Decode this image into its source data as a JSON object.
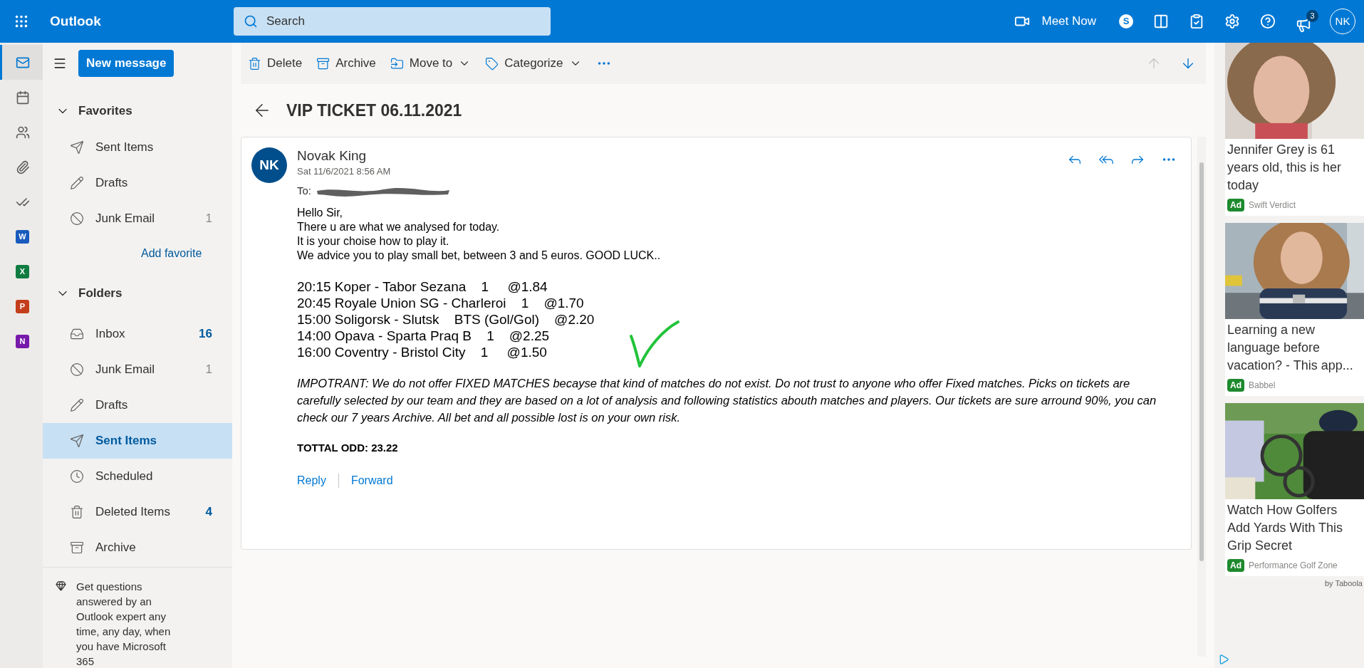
{
  "app_bar": {
    "app_name": "Outlook",
    "search": {
      "placeholder": "Search"
    },
    "meet_now": "Meet Now",
    "skype_letter": "S",
    "notification_count": "3",
    "avatar": "NK"
  },
  "rail": [
    {
      "kind": "mail",
      "selected": true
    },
    {
      "kind": "calendar",
      "selected": false
    },
    {
      "kind": "people",
      "selected": false
    },
    {
      "kind": "files",
      "selected": false
    },
    {
      "kind": "todo",
      "selected": false
    },
    {
      "kind": "app",
      "letter": "W",
      "color": "#185abd",
      "selected": false
    },
    {
      "kind": "app",
      "letter": "X",
      "color": "#107c41",
      "selected": false
    },
    {
      "kind": "app",
      "letter": "P",
      "color": "#c43e1c",
      "selected": false
    },
    {
      "kind": "app",
      "letter": "N",
      "color": "#7719aa",
      "selected": false
    }
  ],
  "folder_pane": {
    "new_message": "New message",
    "sections": [
      {
        "title": "Favorites",
        "expanded": true,
        "items": [
          {
            "kind": "sent",
            "label": "Sent Items",
            "selected": false
          },
          {
            "kind": "drafts",
            "label": "Drafts",
            "selected": false
          },
          {
            "kind": "junk",
            "label": "Junk Email",
            "count": "1",
            "unread": false,
            "selected": false
          }
        ],
        "add_link": "Add favorite"
      },
      {
        "title": "Folders",
        "expanded": true,
        "items": [
          {
            "kind": "inbox",
            "label": "Inbox",
            "count": "16",
            "unread": true,
            "selected": false
          },
          {
            "kind": "junk",
            "label": "Junk Email",
            "count": "1",
            "unread": false,
            "selected": false
          },
          {
            "kind": "drafts",
            "label": "Drafts",
            "selected": false
          },
          {
            "kind": "sent",
            "label": "Sent Items",
            "selected": true
          },
          {
            "kind": "scheduled",
            "label": "Scheduled",
            "selected": false
          },
          {
            "kind": "deleted",
            "label": "Deleted Items",
            "count": "4",
            "unread": true,
            "selected": false
          },
          {
            "kind": "archive",
            "label": "Archive",
            "selected": false
          }
        ]
      }
    ],
    "upsell": "Get questions answered by an Outlook expert any time, any day, when you have Microsoft 365"
  },
  "toolbar": {
    "items": [
      {
        "kind": "delete",
        "label": "Delete"
      },
      {
        "kind": "archive",
        "label": "Archive"
      },
      {
        "kind": "move",
        "label": "Move to"
      },
      {
        "kind": "categorize",
        "label": "Categorize"
      }
    ],
    "up_disabled": true,
    "down_disabled": false
  },
  "message": {
    "subject": "VIP TICKET 06.11.2021",
    "sender": "Novak King",
    "initials": "NK",
    "date": "Sat 11/6/2021 8:56 AM",
    "to_label": "To:",
    "greeting_lines": [
      "Hello Sir,",
      "There u are what we analysed for today.",
      "It is your choise how to play it.",
      "We advice you to play small bet, between 3 and 5 euros. GOOD LUCK.."
    ],
    "picks": [
      "20:15 Koper - Tabor Sezana    1     @1.84",
      "20:45 Royale Union SG - Charleroi    1    @1.70",
      "15:00 Soligorsk - Slutsk    BTS (Gol/Gol)    @2.20",
      "14:00 Opava - Sparta Praq B    1    @2.25",
      "16:00 Coventry - Bristol City    1     @1.50"
    ],
    "notice": "IMPOTRANT: We do not offer FIXED MATCHES becayse that kind of matches do not exist. Do not trust to anyone who offer Fixed matches. Picks on tickets are carefully selected by our team and they are based on a lot of analysis and following statistics abouth matches and players. Our tickets are sure arround 90%, you can check our 7 years Archive. All bet and all possible lost is on your own risk.",
    "total": "TOTTAL ODD: 23.22",
    "actions": [
      "Reply",
      "Forward"
    ]
  },
  "ads": {
    "items": [
      {
        "kind": "picture",
        "title": "Jennifer Grey is 61 years old, this is her today",
        "badge": "Ad",
        "source": "Swift Verdict"
      },
      {
        "kind": "picture",
        "title": "Learning a new language before vacation? - This app...",
        "badge": "Ad",
        "source": "Babbel"
      },
      {
        "kind": "picture",
        "title": "Watch How Golfers Add Yards With This Grip Secret",
        "badge": "Ad",
        "source": "Performance Golf Zone"
      }
    ],
    "provider": "by Taboola"
  }
}
